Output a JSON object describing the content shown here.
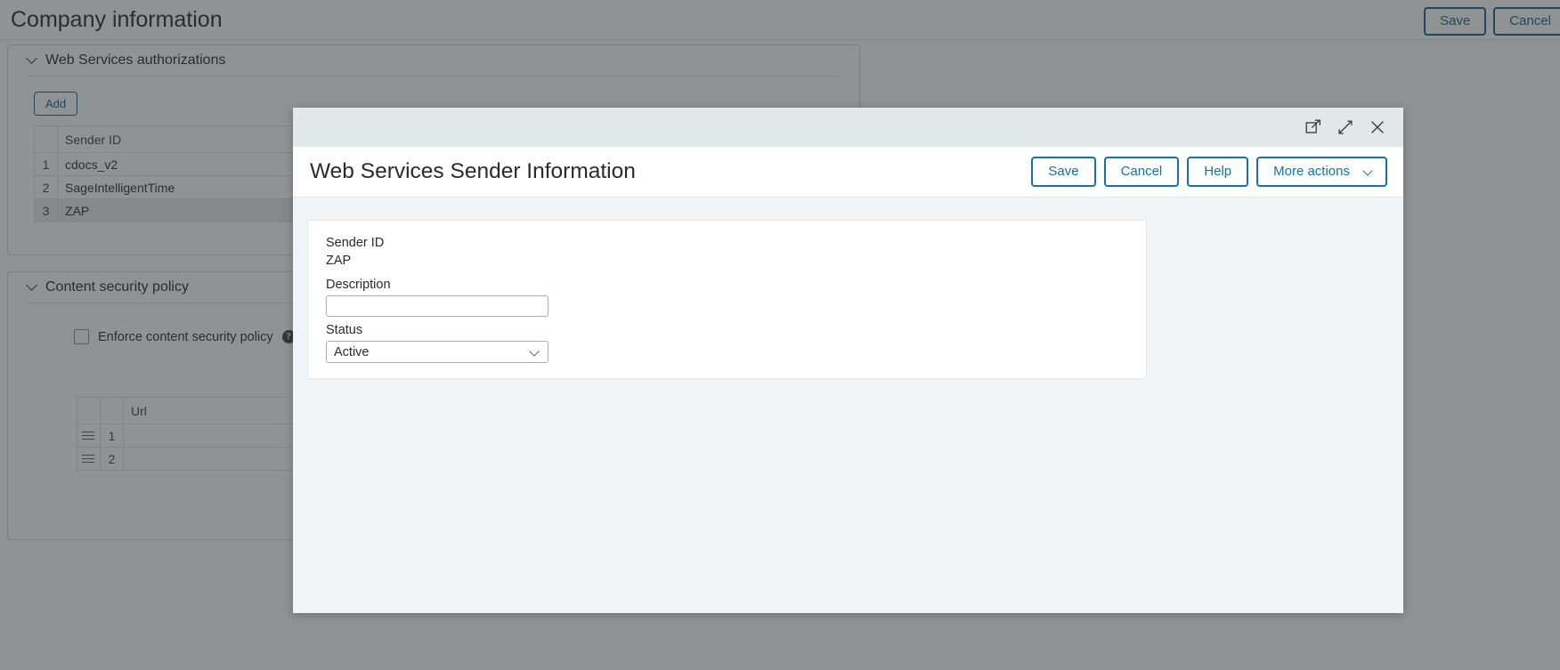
{
  "page": {
    "title": "Company information",
    "actions": [
      {
        "label": "Save",
        "name": "save-button"
      },
      {
        "label": "Cancel",
        "name": "cancel-button"
      }
    ]
  },
  "web_services_section": {
    "title": "Web Services authorizations",
    "add_label": "Add",
    "columns": [
      "",
      "Sender ID"
    ],
    "rows": [
      {
        "num": "1",
        "sender_id": "cdocs_v2",
        "selected": false
      },
      {
        "num": "2",
        "sender_id": "SageIntelligentTime",
        "selected": false
      },
      {
        "num": "3",
        "sender_id": "ZAP",
        "selected": true
      }
    ]
  },
  "content_security_section": {
    "title": "Content security policy",
    "checkbox_label": "Enforce content security policy",
    "checkbox_checked": false,
    "help_glyph": "?",
    "columns": [
      "",
      "",
      "Url"
    ],
    "rows": [
      {
        "num": "1",
        "url": ""
      },
      {
        "num": "2",
        "url": ""
      }
    ]
  },
  "modal": {
    "title": "Web Services Sender Information",
    "window_icons": [
      {
        "name": "pop-out-icon"
      },
      {
        "name": "expand-icon"
      },
      {
        "name": "close-icon"
      }
    ],
    "actions": [
      {
        "label": "Save",
        "name": "modal-save-button",
        "chevron": false
      },
      {
        "label": "Cancel",
        "name": "modal-cancel-button",
        "chevron": false
      },
      {
        "label": "Help",
        "name": "modal-help-button",
        "chevron": false
      },
      {
        "label": "More actions",
        "name": "more-actions-button",
        "chevron": true
      }
    ],
    "form": {
      "sender_id_label": "Sender ID",
      "sender_id_value": "ZAP",
      "description_label": "Description",
      "description_value": "",
      "description_placeholder": "",
      "status_label": "Status",
      "status_value": "Active"
    }
  },
  "colors": {
    "accent_blue": "#0f72b5",
    "header_blue": "#14628c",
    "modal_topbar": "#e2e8ea",
    "modal_body": "#f1f4f6",
    "scrim": "rgba(43,47,50,0.52)"
  }
}
